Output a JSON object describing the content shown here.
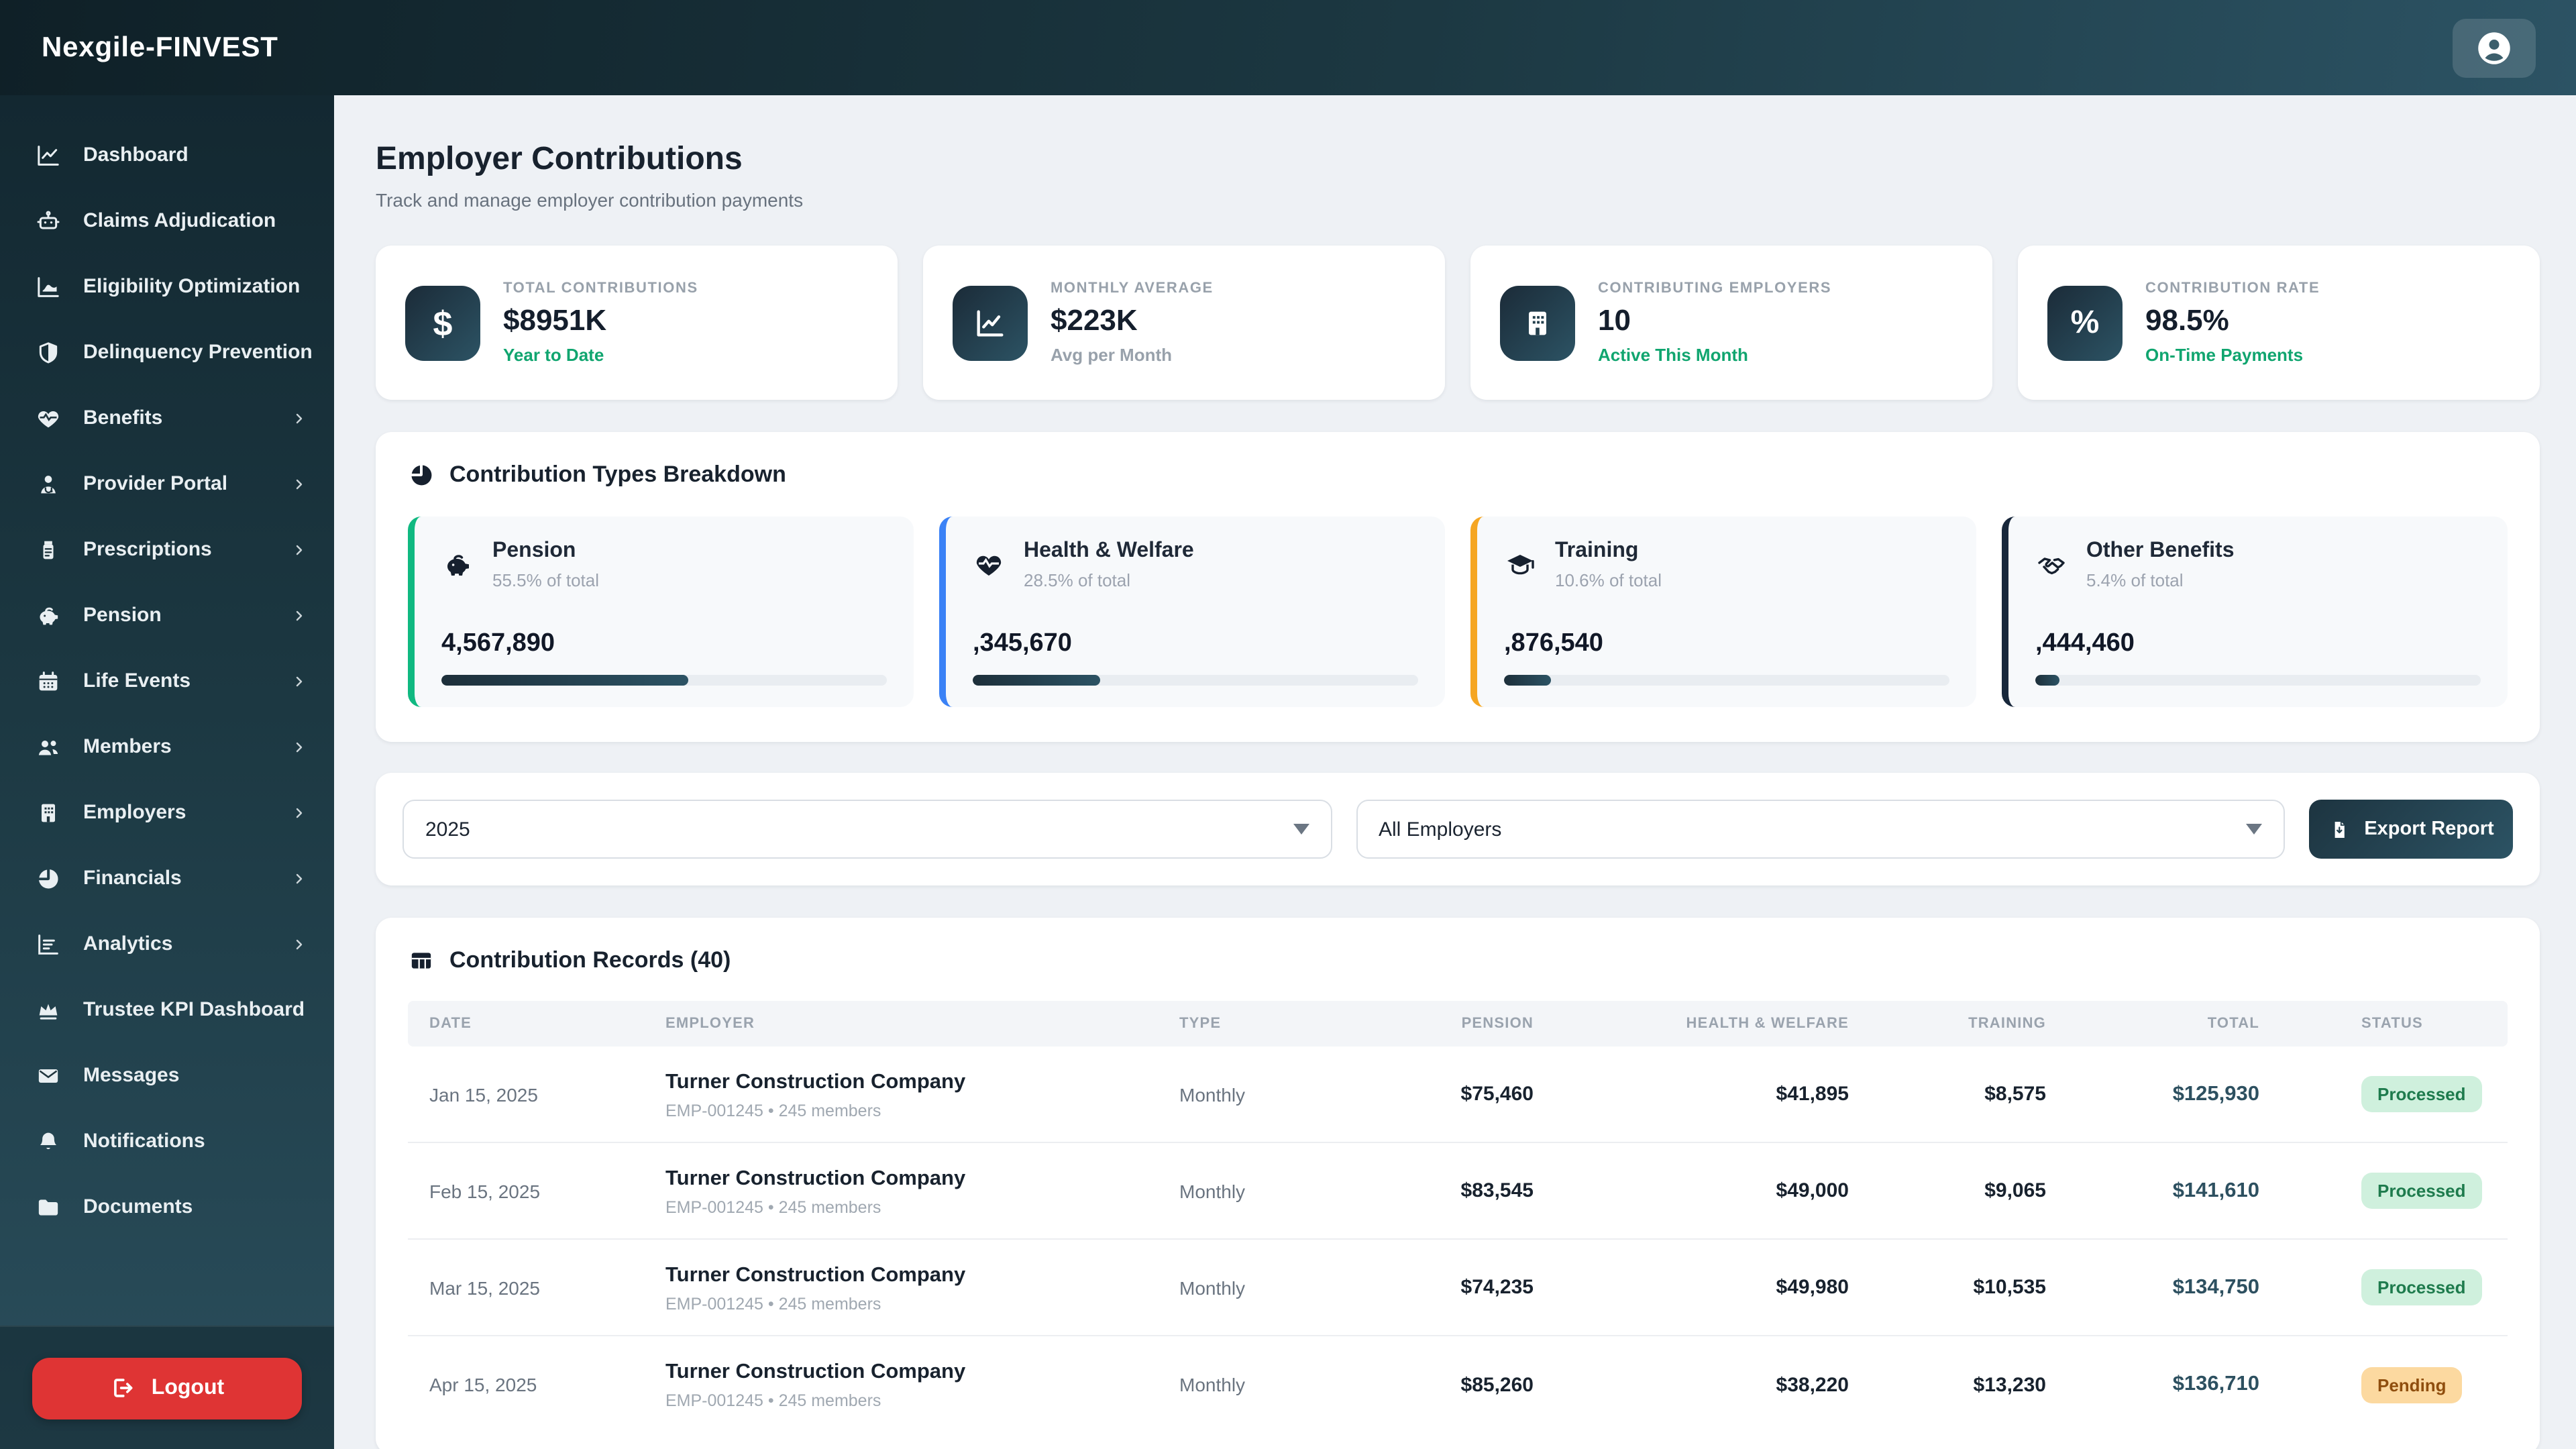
{
  "app": {
    "brand": "Nexgile-FINVEST"
  },
  "sidebar": {
    "items": [
      {
        "label": "Dashboard",
        "icon": "chart-line-icon",
        "has_submenu": false
      },
      {
        "label": "Claims Adjudication",
        "icon": "robot-icon",
        "has_submenu": false
      },
      {
        "label": "Eligibility Optimization",
        "icon": "area-chart-icon",
        "has_submenu": false
      },
      {
        "label": "Delinquency Prevention",
        "icon": "shield-icon",
        "has_submenu": false
      },
      {
        "label": "Benefits",
        "icon": "heart-pulse-icon",
        "has_submenu": true
      },
      {
        "label": "Provider Portal",
        "icon": "doctor-icon",
        "has_submenu": true
      },
      {
        "label": "Prescriptions",
        "icon": "pill-bottle-icon",
        "has_submenu": true
      },
      {
        "label": "Pension",
        "icon": "piggy-bank-icon",
        "has_submenu": true
      },
      {
        "label": "Life Events",
        "icon": "calendar-icon",
        "has_submenu": true
      },
      {
        "label": "Members",
        "icon": "users-icon",
        "has_submenu": true
      },
      {
        "label": "Employers",
        "icon": "building-icon",
        "has_submenu": true
      },
      {
        "label": "Financials",
        "icon": "pie-chart-icon",
        "has_submenu": true
      },
      {
        "label": "Analytics",
        "icon": "bar-chart-icon",
        "has_submenu": true
      },
      {
        "label": "Trustee KPI Dashboard",
        "icon": "crown-icon",
        "has_submenu": false
      },
      {
        "label": "Messages",
        "icon": "envelope-icon",
        "has_submenu": false
      },
      {
        "label": "Notifications",
        "icon": "bell-icon",
        "has_submenu": false
      },
      {
        "label": "Documents",
        "icon": "folder-icon",
        "has_submenu": false
      }
    ],
    "logout_label": "Logout"
  },
  "page": {
    "title": "Employer Contributions",
    "subtitle": "Track and manage employer contribution payments"
  },
  "stats": [
    {
      "label": "TOTAL CONTRIBUTIONS",
      "value": "$8951K",
      "sub": "Year to Date",
      "sub_color": "#10a56f",
      "icon": "dollar-icon"
    },
    {
      "label": "MONTHLY AVERAGE",
      "value": "$223K",
      "sub": "Avg per Month",
      "sub_color": "#98a1ab",
      "icon": "line-chart-icon"
    },
    {
      "label": "CONTRIBUTING EMPLOYERS",
      "value": "10",
      "sub": "Active This Month",
      "sub_color": "#10a56f",
      "icon": "building-icon"
    },
    {
      "label": "CONTRIBUTION RATE",
      "value": "98.5%",
      "sub": "On-Time Payments",
      "sub_color": "#10a56f",
      "icon": "percent-icon"
    }
  ],
  "breakdown": {
    "title": "Contribution Types Breakdown",
    "items": [
      {
        "name": "Pension",
        "pct": "55.5% of total",
        "value": "4,567,890",
        "accent": "#10b981",
        "bar_width": "55.5%",
        "icon": "piggy-bank-icon"
      },
      {
        "name": "Health & Welfare",
        "pct": "28.5% of total",
        "value": ",345,670",
        "accent": "#3b82f6",
        "bar_width": "28.5%",
        "icon": "heart-pulse-icon"
      },
      {
        "name": "Training",
        "pct": "10.6% of total",
        "value": ",876,540",
        "accent": "#f5a623",
        "bar_width": "10.6%",
        "icon": "graduation-cap-icon"
      },
      {
        "name": "Other Benefits",
        "pct": "5.4% of total",
        "value": ",444,460",
        "accent": "#18273b",
        "bar_width": "5.4%",
        "icon": "hands-icon"
      }
    ]
  },
  "filters": {
    "year": "2025",
    "employer": "All Employers",
    "export_label": "Export Report"
  },
  "records": {
    "title": "Contribution Records (40)",
    "columns": [
      "Date",
      "Employer",
      "Type",
      "Pension",
      "Health & Welfare",
      "Training",
      "Total",
      "Status"
    ],
    "rows": [
      {
        "date": "Jan 15, 2025",
        "employer": "Turner Construction Company",
        "employer_sub": "EMP-001245 • 245 members",
        "type": "Monthly",
        "pension": "$75,460",
        "health_welfare": "$41,895",
        "training": "$8,575",
        "total": "$125,930",
        "status": "Processed"
      },
      {
        "date": "Feb 15, 2025",
        "employer": "Turner Construction Company",
        "employer_sub": "EMP-001245 • 245 members",
        "type": "Monthly",
        "pension": "$83,545",
        "health_welfare": "$49,000",
        "training": "$9,065",
        "total": "$141,610",
        "status": "Processed"
      },
      {
        "date": "Mar 15, 2025",
        "employer": "Turner Construction Company",
        "employer_sub": "EMP-001245 • 245 members",
        "type": "Monthly",
        "pension": "$74,235",
        "health_welfare": "$49,980",
        "training": "$10,535",
        "total": "$134,750",
        "status": "Processed"
      },
      {
        "date": "Apr 15, 2025",
        "employer": "Turner Construction Company",
        "employer_sub": "EMP-001245 • 245 members",
        "type": "Monthly",
        "pension": "$85,260",
        "health_welfare": "$38,220",
        "training": "$13,230",
        "total": "$136,710",
        "status": "Pending"
      }
    ]
  }
}
